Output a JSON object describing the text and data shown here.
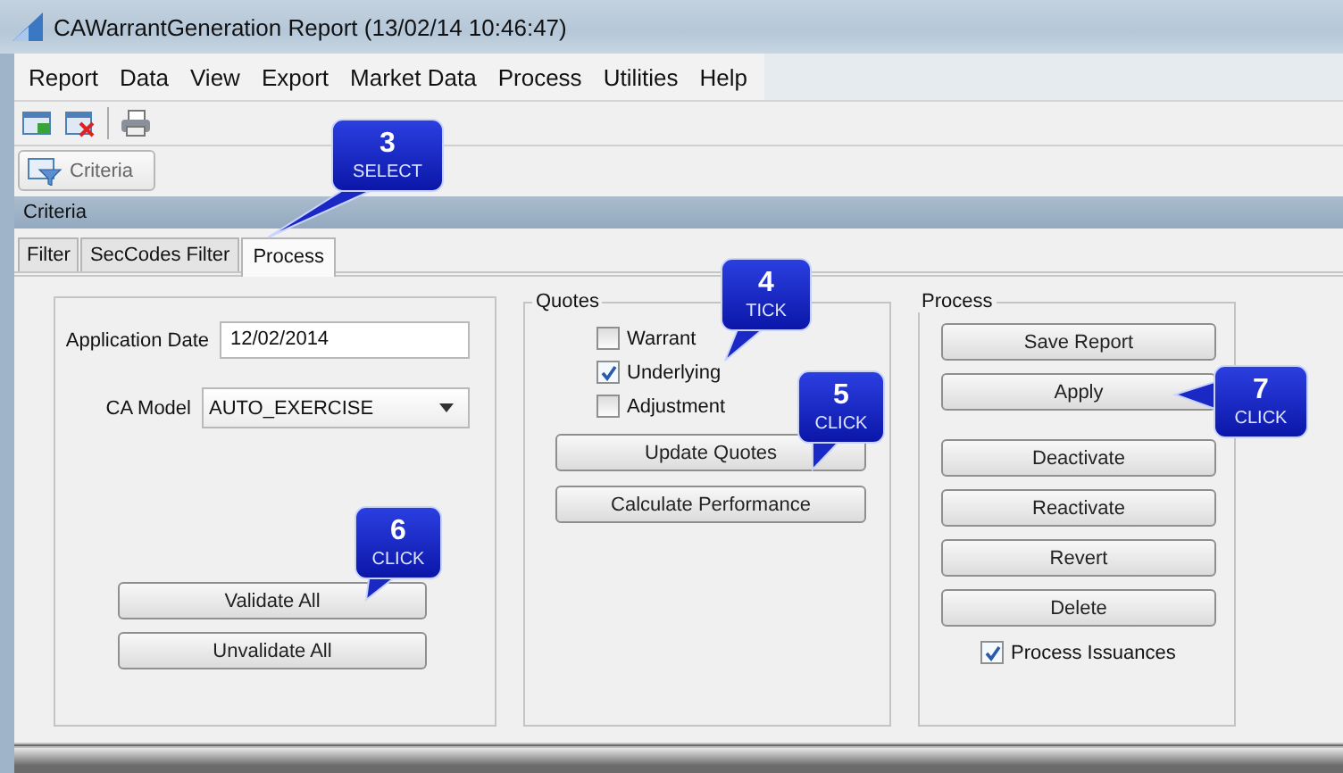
{
  "window": {
    "title": "CAWarrantGeneration Report (13/02/14 10:46:47)"
  },
  "menu": [
    "Report",
    "Data",
    "View",
    "Export",
    "Market Data",
    "Process",
    "Utilities",
    "Help"
  ],
  "toolbar_button": {
    "label": "Criteria"
  },
  "section_title": "Criteria",
  "tabs": [
    {
      "label": "Filter",
      "selected": false
    },
    {
      "label": "SecCodes Filter",
      "selected": false
    },
    {
      "label": "Process",
      "selected": true
    }
  ],
  "form": {
    "fields": [
      {
        "kind": "text",
        "label": "Application Date",
        "value": "12/02/2014"
      },
      {
        "kind": "select",
        "label": "CA Model",
        "value": "AUTO_EXERCISE"
      }
    ],
    "buttons": [
      "Validate All",
      "Unvalidate All"
    ]
  },
  "quotes": {
    "title": "Quotes",
    "checkboxes": [
      {
        "label": "Warrant",
        "checked": false
      },
      {
        "label": "Underlying",
        "checked": true
      },
      {
        "label": "Adjustment",
        "checked": false
      }
    ],
    "buttons": [
      "Update Quotes",
      "Calculate Performance"
    ]
  },
  "process": {
    "title": "Process",
    "buttons": [
      "Save Report",
      "Apply",
      "Deactivate",
      "Reactivate",
      "Revert",
      "Delete"
    ],
    "checkbox": {
      "label": "Process Issuances",
      "checked": true
    }
  },
  "callouts": [
    {
      "number": "3",
      "action": "SELECT"
    },
    {
      "number": "4",
      "action": "TICK"
    },
    {
      "number": "5",
      "action": "CLICK"
    },
    {
      "number": "6",
      "action": "CLICK"
    },
    {
      "number": "7",
      "action": "CLICK"
    }
  ]
}
